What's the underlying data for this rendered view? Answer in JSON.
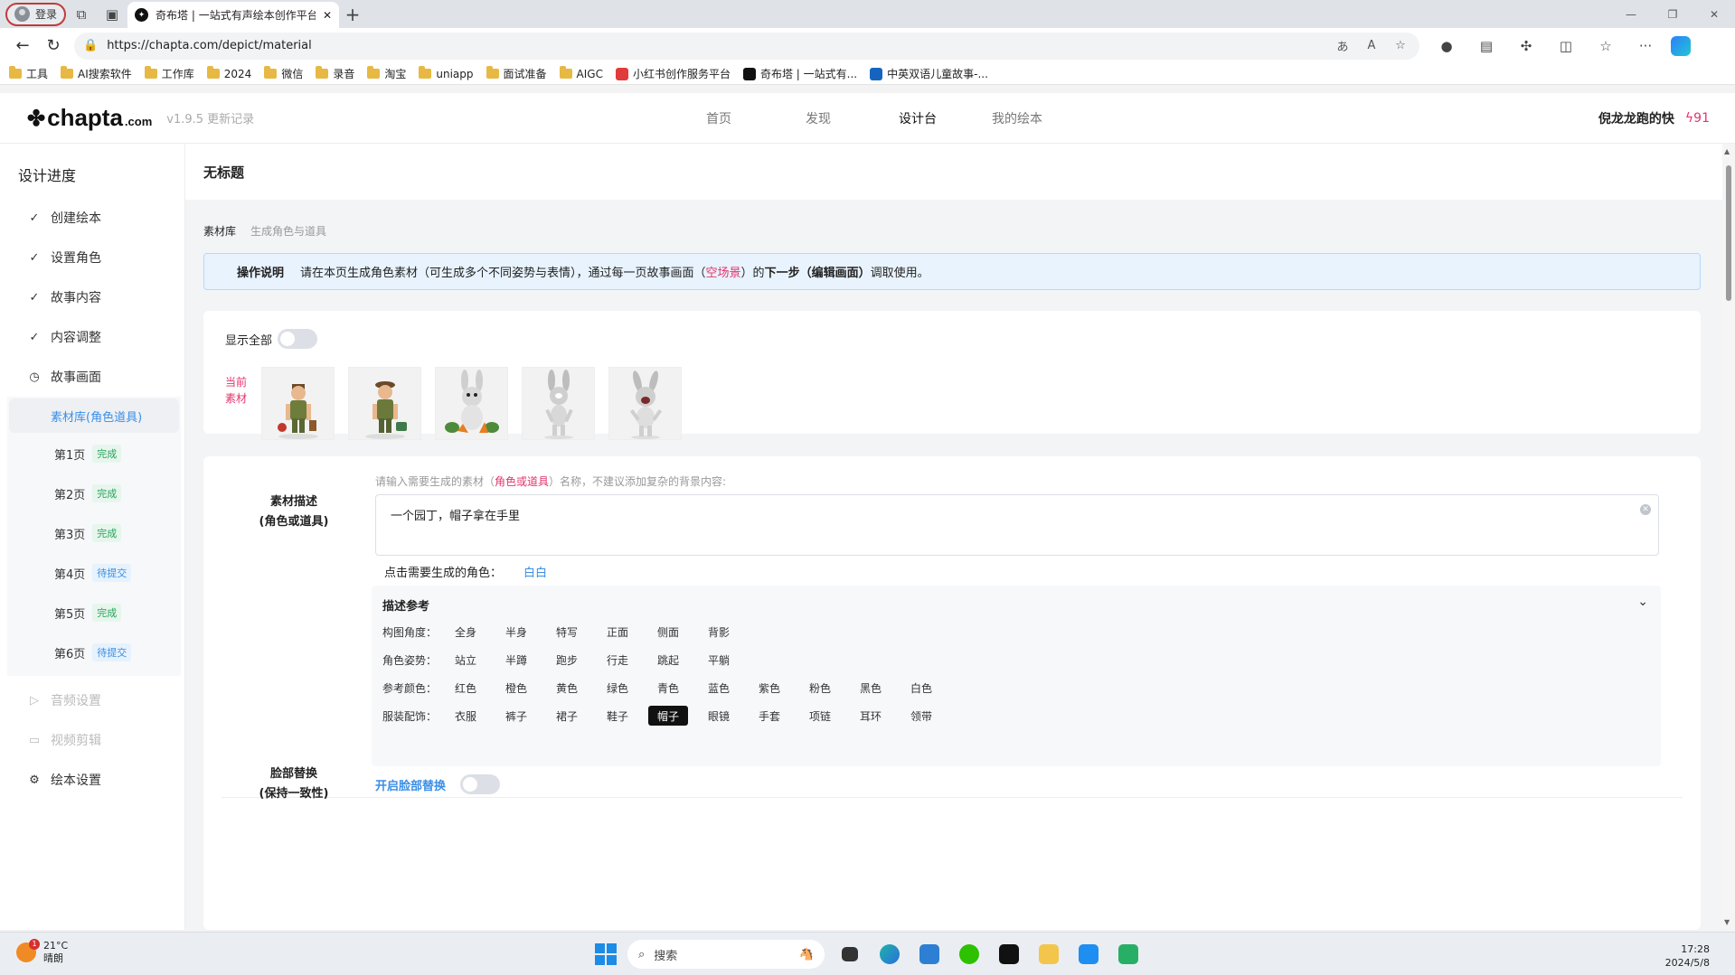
{
  "browser": {
    "profile_label": "登录",
    "tab_title": "奇布塔 | 一站式有声绘本创作平台",
    "url": "https://chapta.com/depict/material",
    "bookmarks": [
      {
        "label": "工具",
        "type": "folder"
      },
      {
        "label": "AI搜索软件",
        "type": "folder"
      },
      {
        "label": "工作库",
        "type": "folder"
      },
      {
        "label": "2024",
        "type": "folder"
      },
      {
        "label": "微信",
        "type": "folder"
      },
      {
        "label": "录音",
        "type": "folder"
      },
      {
        "label": "淘宝",
        "type": "folder"
      },
      {
        "label": "uniapp",
        "type": "folder"
      },
      {
        "label": "面试准备",
        "type": "folder"
      },
      {
        "label": "AIGC",
        "type": "folder"
      },
      {
        "label": "小红书创作服务平台",
        "type": "site",
        "color": "#e23b3b"
      },
      {
        "label": "奇布塔 | 一站式有...",
        "type": "site",
        "color": "#111111"
      },
      {
        "label": "中英双语儿童故事-...",
        "type": "site",
        "color": "#1565c0"
      }
    ]
  },
  "header": {
    "logo": "chapta",
    "logo_suffix": ".com",
    "version": "v1.9.5 更新记录",
    "nav": [
      {
        "label": "首页",
        "active": false
      },
      {
        "label": "发现",
        "active": false
      },
      {
        "label": "设计台",
        "active": true
      },
      {
        "label": "我的绘本",
        "active": false
      }
    ],
    "username": "倪龙龙跑的快",
    "credits": "91"
  },
  "sidebar": {
    "title": "设计进度",
    "steps": [
      {
        "label": "创建绘本",
        "icon": "check-icon"
      },
      {
        "label": "设置角色",
        "icon": "check-icon"
      },
      {
        "label": "故事内容",
        "icon": "check-icon"
      },
      {
        "label": "内容调整",
        "icon": "check-icon"
      },
      {
        "label": "故事画面",
        "icon": "clock-icon"
      }
    ],
    "active_sub": "素材库(角色道具)",
    "pages": [
      {
        "label": "第1页",
        "status": "完成"
      },
      {
        "label": "第2页",
        "status": "完成"
      },
      {
        "label": "第3页",
        "status": "完成"
      },
      {
        "label": "第4页",
        "status": "待提交"
      },
      {
        "label": "第5页",
        "status": "完成"
      },
      {
        "label": "第6页",
        "status": "待提交"
      }
    ],
    "disabled": [
      {
        "label": "音频设置",
        "icon": "play-icon"
      },
      {
        "label": "视频剪辑",
        "icon": "video-icon"
      }
    ],
    "settings": "绘本设置"
  },
  "main": {
    "title": "无标题",
    "subtabs": [
      "素材库",
      "生成角色与道具"
    ],
    "notice": {
      "label": "操作说明",
      "text_a": "请在本页生成角色素材（可生成多个不同姿势与表情），通过每一页故事画面（",
      "highlight": "空场景",
      "text_b": "）的",
      "bold": "下一步（编辑画面）",
      "text_c": "调取使用。"
    },
    "show_all": "显示全部",
    "current_label": "当前\n素材",
    "assets": [
      "gardener",
      "gardener",
      "rabbit",
      "rabbit",
      "rabbit"
    ],
    "form": {
      "desc_label": "素材描述\n(角色或道具)",
      "hint_a": "请输入需要生成的素材（",
      "hint_hl": "角色或道具",
      "hint_b": "）名称，不建议添加复杂的背景内容:",
      "value": "一个园丁，帽子拿在手里",
      "pick_label": "点击需要生成的角色：",
      "pick_option": "白白",
      "ref_title": "描述参考",
      "rows": [
        {
          "label": "构图角度：",
          "chips": [
            "全身",
            "半身",
            "特写",
            "正面",
            "侧面",
            "背影"
          ]
        },
        {
          "label": "角色姿势：",
          "chips": [
            "站立",
            "半蹲",
            "跑步",
            "行走",
            "跳起",
            "平躺"
          ]
        },
        {
          "label": "参考颜色：",
          "chips": [
            "红色",
            "橙色",
            "黄色",
            "绿色",
            "青色",
            "蓝色",
            "紫色",
            "粉色",
            "黑色",
            "白色"
          ]
        },
        {
          "label": "服装配饰：",
          "chips": [
            "衣服",
            "裤子",
            "裙子",
            "鞋子",
            "帽子",
            "眼镜",
            "手套",
            "项链",
            "耳环",
            "领带"
          ],
          "selected": "帽子"
        }
      ],
      "face_label": "脸部替换\n(保持一致性)",
      "face_link": "开启脸部替换"
    }
  },
  "taskbar": {
    "temp": "21°C",
    "weather": "晴朗",
    "badge": "1",
    "search": "搜索",
    "time": "17:28",
    "date": "2024/5/8"
  },
  "colors": {
    "accent": "#3a8ee6",
    "highlight": "#e5336b",
    "done": "#27a25b"
  }
}
